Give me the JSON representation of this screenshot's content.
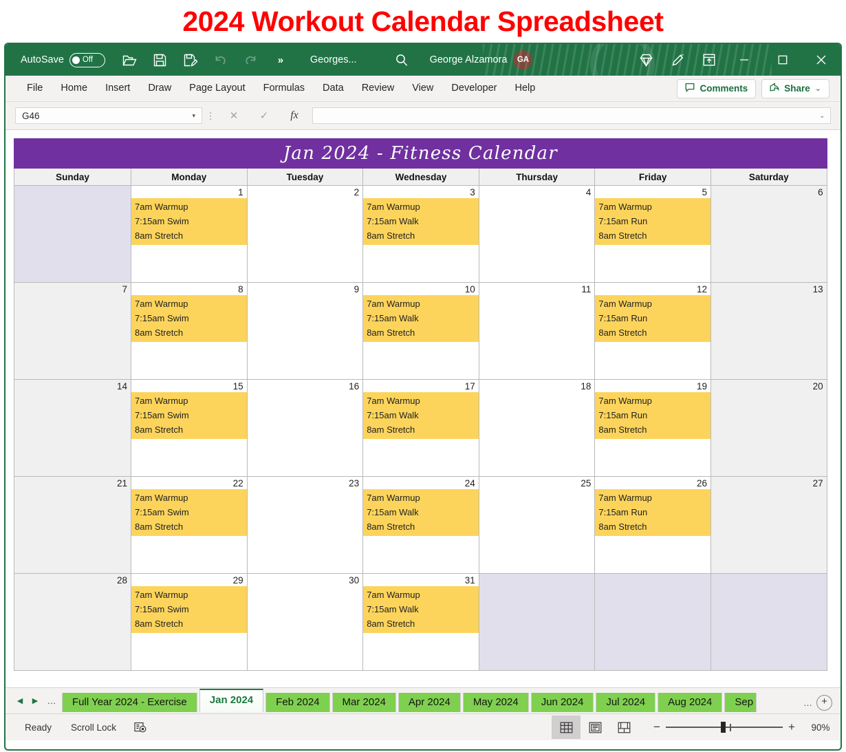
{
  "banner": {
    "title": "2024 Workout Calendar Spreadsheet",
    "color": "#ff0000"
  },
  "titlebar": {
    "autosave_label": "AutoSave",
    "autosave_state": "Off",
    "doc_name": "Georges...",
    "account_name": "George Alzamora",
    "account_initials": "GA",
    "overflow_label": "»",
    "icons": [
      "open-icon",
      "save-icon",
      "save-as-icon",
      "undo-icon",
      "redo-icon",
      "search-icon",
      "diamond-icon",
      "pen-icon",
      "ribbon-display-icon",
      "minimize-icon",
      "maximize-icon",
      "close-icon"
    ]
  },
  "ribbon": {
    "tabs": [
      "File",
      "Home",
      "Insert",
      "Draw",
      "Page Layout",
      "Formulas",
      "Data",
      "Review",
      "View",
      "Developer",
      "Help"
    ],
    "comments_label": "Comments",
    "share_label": "Share",
    "share_caret": "⌄"
  },
  "formula_bar": {
    "name_box_value": "G46",
    "name_box_caret": "▾",
    "cancel_icon": "✕",
    "enter_icon": "✓",
    "fx_label": "fx",
    "formula_value": "",
    "expand_caret": "⌄"
  },
  "calendar": {
    "title": "Jan 2024  -  Fitness Calendar",
    "title_bg": "#7030a0",
    "weekend_bg": "#f0f0f0",
    "blank_bg": "#e2dfec",
    "workout_bg": "#fcd45c",
    "day_headers": [
      "Sunday",
      "Monday",
      "Tuesday",
      "Wednesday",
      "Thursday",
      "Friday",
      "Saturday"
    ],
    "weeks": [
      [
        {
          "num": "",
          "blank": true,
          "weekend": true,
          "workout": []
        },
        {
          "num": "1",
          "weekend": false,
          "workout": [
            "7am Warmup",
            "7:15am Swim",
            "8am Stretch"
          ]
        },
        {
          "num": "2",
          "weekend": false,
          "workout": []
        },
        {
          "num": "3",
          "weekend": false,
          "workout": [
            "7am Warmup",
            "7:15am Walk",
            "8am Stretch"
          ]
        },
        {
          "num": "4",
          "weekend": false,
          "workout": []
        },
        {
          "num": "5",
          "weekend": false,
          "workout": [
            "7am Warmup",
            "7:15am Run",
            "8am Stretch"
          ]
        },
        {
          "num": "6",
          "weekend": true,
          "workout": []
        }
      ],
      [
        {
          "num": "7",
          "weekend": true,
          "workout": []
        },
        {
          "num": "8",
          "weekend": false,
          "workout": [
            "7am Warmup",
            "7:15am Swim",
            "8am Stretch"
          ]
        },
        {
          "num": "9",
          "weekend": false,
          "workout": []
        },
        {
          "num": "10",
          "weekend": false,
          "workout": [
            "7am Warmup",
            "7:15am Walk",
            "8am Stretch"
          ]
        },
        {
          "num": "11",
          "weekend": false,
          "workout": []
        },
        {
          "num": "12",
          "weekend": false,
          "workout": [
            "7am Warmup",
            "7:15am Run",
            "8am Stretch"
          ]
        },
        {
          "num": "13",
          "weekend": true,
          "workout": []
        }
      ],
      [
        {
          "num": "14",
          "weekend": true,
          "workout": []
        },
        {
          "num": "15",
          "weekend": false,
          "workout": [
            "7am Warmup",
            "7:15am Swim",
            "8am Stretch"
          ]
        },
        {
          "num": "16",
          "weekend": false,
          "workout": []
        },
        {
          "num": "17",
          "weekend": false,
          "workout": [
            "7am Warmup",
            "7:15am Walk",
            "8am Stretch"
          ]
        },
        {
          "num": "18",
          "weekend": false,
          "workout": []
        },
        {
          "num": "19",
          "weekend": false,
          "workout": [
            "7am Warmup",
            "7:15am Run",
            "8am Stretch"
          ]
        },
        {
          "num": "20",
          "weekend": true,
          "workout": []
        }
      ],
      [
        {
          "num": "21",
          "weekend": true,
          "workout": []
        },
        {
          "num": "22",
          "weekend": false,
          "workout": [
            "7am Warmup",
            "7:15am Swim",
            "8am Stretch"
          ]
        },
        {
          "num": "23",
          "weekend": false,
          "workout": []
        },
        {
          "num": "24",
          "weekend": false,
          "workout": [
            "7am Warmup",
            "7:15am Walk",
            "8am Stretch"
          ]
        },
        {
          "num": "25",
          "weekend": false,
          "workout": []
        },
        {
          "num": "26",
          "weekend": false,
          "workout": [
            "7am Warmup",
            "7:15am Run",
            "8am Stretch"
          ]
        },
        {
          "num": "27",
          "weekend": true,
          "workout": []
        }
      ],
      [
        {
          "num": "28",
          "weekend": true,
          "workout": []
        },
        {
          "num": "29",
          "weekend": false,
          "workout": [
            "7am Warmup",
            "7:15am Swim",
            "8am Stretch"
          ]
        },
        {
          "num": "30",
          "weekend": false,
          "workout": []
        },
        {
          "num": "31",
          "weekend": false,
          "workout": [
            "7am Warmup",
            "7:15am Walk",
            "8am Stretch"
          ]
        },
        {
          "num": "",
          "blank": true,
          "weekend": false,
          "workout": []
        },
        {
          "num": "",
          "blank": true,
          "weekend": false,
          "workout": []
        },
        {
          "num": "",
          "blank": true,
          "weekend": true,
          "workout": []
        }
      ]
    ]
  },
  "sheet_tabs": {
    "nav_first": "◀",
    "nav_last": "▶",
    "nav_dots": "…",
    "tabs": [
      {
        "label": "Full Year 2024 - Exercise",
        "active": false
      },
      {
        "label": "Jan 2024",
        "active": true
      },
      {
        "label": "Feb 2024",
        "active": false
      },
      {
        "label": "Mar 2024",
        "active": false
      },
      {
        "label": "Apr 2024",
        "active": false
      },
      {
        "label": "May 2024",
        "active": false
      },
      {
        "label": "Jun 2024",
        "active": false
      },
      {
        "label": "Jul 2024",
        "active": false
      },
      {
        "label": "Aug 2024",
        "active": false
      },
      {
        "label": "Sep",
        "active": false
      }
    ],
    "overflow_dots": "…",
    "add_sheet_label": "+",
    "tab_color": "#7fd04f"
  },
  "status_bar": {
    "ready_label": "Ready",
    "scroll_lock_label": "Scroll Lock",
    "macro_icon": "record-macro-icon",
    "views": [
      "normal-view-icon",
      "page-layout-view-icon",
      "page-break-view-icon"
    ],
    "zoom_out": "−",
    "zoom_in": "+",
    "zoom_level": "90%"
  }
}
